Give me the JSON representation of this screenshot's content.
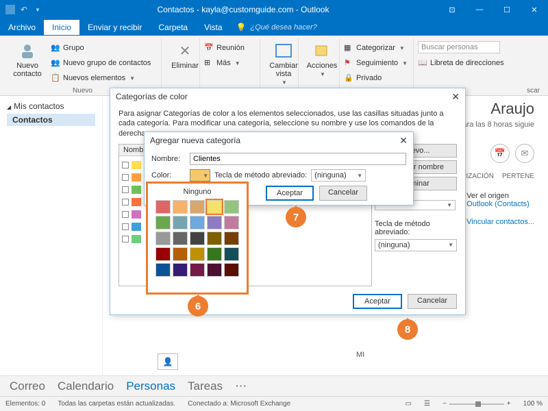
{
  "window": {
    "title": "Contactos - kayla@customguide.com - Outlook"
  },
  "menu": {
    "archivo": "Archivo",
    "inicio": "Inicio",
    "enviar": "Enviar y recibir",
    "carpeta": "Carpeta",
    "vista": "Vista",
    "hint": "¿Qué desea hacer?"
  },
  "ribbon": {
    "nuevo_contacto": "Nuevo contacto",
    "grupo": "Grupo",
    "nuevo_grupo": "Nuevo grupo de contactos",
    "nuevos_elementos": "Nuevos elementos",
    "group_nuevo": "Nuevo",
    "eliminar": "Eliminar",
    "reunion": "Reunión",
    "mas": "Más",
    "cambiar_vista": "Cambiar vista",
    "acciones": "Acciones",
    "categorizar": "Categorizar",
    "seguimiento": "Seguimiento",
    "privado": "Privado",
    "buscar_placeholder": "Buscar personas",
    "libreta": "Libreta de direcciones",
    "buscar_tab": "scar"
  },
  "sidebar": {
    "heading": "Mis contactos",
    "item": "Contactos"
  },
  "contact": {
    "name": "Araujo",
    "sub": "para las 8 horas siguie",
    "tab1": "NIZACIÓN",
    "tab2": "PERTENE",
    "ver": "Ver el origen",
    "origen": "Outlook (Contacts)",
    "vincular": "Vincular contactos...",
    "mi": "MI"
  },
  "dialog1": {
    "title": "Categorías de color",
    "desc": "Para asignar Categorías de color a los elementos seleccionados, use las casillas situadas junto a cada categoría. Para modificar una categoría, seleccione su nombre y use los comandos de la derecha.",
    "col_name": "Nomb",
    "nuevo": "Nuevo...",
    "cambiar": "Cambiar nombre",
    "eliminar": "Eliminar",
    "tecla_label": "Tecla de método abreviado:",
    "ninguna": "(ninguna)",
    "aceptar": "Aceptar",
    "cancelar": "Cancelar",
    "cat_colors": [
      "#ffe04f",
      "#ff9f3f",
      "#6fc15a",
      "#ff6f3f",
      "#d070c0",
      "#3f9fe0",
      "#6fcf7f"
    ]
  },
  "dialog2": {
    "title": "Agregar nueva categoría",
    "nombre_label": "Nombre:",
    "nombre_value": "Clientes",
    "color_label": "Color:",
    "tecla_label": "Tecla de método abreviado:",
    "ninguna": "(ninguna)",
    "aceptar": "Aceptar",
    "cancelar": "Cancelar"
  },
  "colorpicker": {
    "title": "Ninguno",
    "colors": [
      "#e06666",
      "#f6b26b",
      "#d9a66b",
      "#f6e26b",
      "#93c47d",
      "#6aa84f",
      "#76a5af",
      "#6fa8dc",
      "#8e7cc3",
      "#c27ba0",
      "#999999",
      "#666666",
      "#434343",
      "#7f6000",
      "#783f04",
      "#990000",
      "#b45f06",
      "#bf9000",
      "#38761d",
      "#134f5c",
      "#0b5394",
      "#351c75",
      "#741b47",
      "#4c1130",
      "#5b0f00"
    ],
    "selected_index": 3
  },
  "nav": {
    "correo": "Correo",
    "calendario": "Calendario",
    "personas": "Personas",
    "tareas": "Tareas"
  },
  "status": {
    "elementos": "Elementos: 0",
    "carpetas": "Todas las carpetas están actualizadas.",
    "conectado": "Conectado a: Microsoft Exchange",
    "zoom": "100 %"
  },
  "callouts": {
    "c6": "6",
    "c7": "7",
    "c8": "8"
  }
}
